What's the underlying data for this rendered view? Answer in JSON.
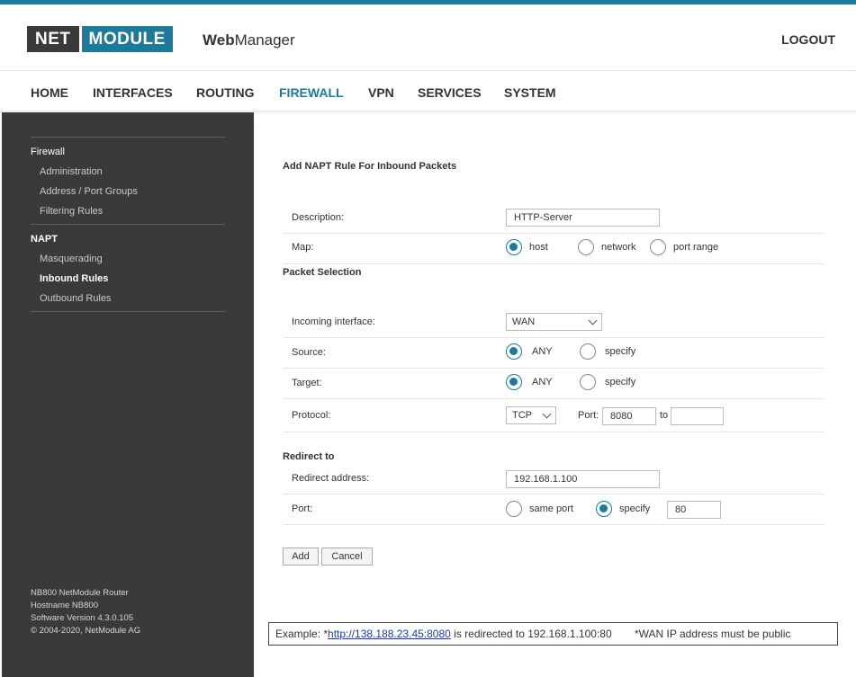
{
  "brand": {
    "logo_left": "NET",
    "logo_right": "MODULE",
    "app_bold": "Web",
    "app_rest": "Manager",
    "logout": "LOGOUT"
  },
  "nav": [
    "HOME",
    "INTERFACES",
    "ROUTING",
    "FIREWALL",
    "VPN",
    "SERVICES",
    "SYSTEM"
  ],
  "nav_active": "FIREWALL",
  "sidebar": {
    "group1": "Firewall",
    "group1_items": [
      "Administration",
      "Address / Port Groups",
      "Filtering Rules"
    ],
    "group2": "NAPT",
    "group2_items": [
      "Masquerading",
      "Inbound Rules",
      "Outbound Rules"
    ],
    "current": "Inbound Rules",
    "footer": [
      "NB800 NetModule Router",
      "Hostname NB800",
      "Software Version 4.3.0.105",
      "© 2004-2020, NetModule AG"
    ]
  },
  "form": {
    "title": "Add NAPT Rule For Inbound Packets",
    "description_label": "Description:",
    "description_value": "HTTP-Server",
    "map_label": "Map:",
    "map_options": [
      "host",
      "network",
      "port range"
    ],
    "map_selected": "host",
    "packet_selection": "Packet Selection",
    "incoming_label": "Incoming interface:",
    "incoming_value": "WAN",
    "source_label": "Source:",
    "source_options": [
      "ANY",
      "specify"
    ],
    "source_selected": "ANY",
    "target_label": "Target:",
    "target_options": [
      "ANY",
      "specify"
    ],
    "target_selected": "ANY",
    "protocol_label": "Protocol:",
    "protocol_value": "TCP",
    "port_label": "Port:",
    "port_from": "8080",
    "port_to_label": "to",
    "port_to": "",
    "redirect_title": "Redirect to",
    "redirect_address_label": "Redirect address:",
    "redirect_address_value": "192.168.1.100",
    "redirect_port_label": "Port:",
    "redirect_port_options": [
      "same port",
      "specify"
    ],
    "redirect_port_selected": "specify",
    "redirect_port_value": "80",
    "add_button": "Add",
    "cancel_button": "Cancel"
  },
  "example": {
    "prefix": "Example: *",
    "link": "http://138.188.23.45:8080",
    "middle": " is redirected to 192.168.1.100:80",
    "note": "*WAN IP address must be public"
  },
  "colors": {
    "accent": "#1d7a9a",
    "sidebar_bg": "#3a3a3a",
    "link": "#1a36c8"
  }
}
